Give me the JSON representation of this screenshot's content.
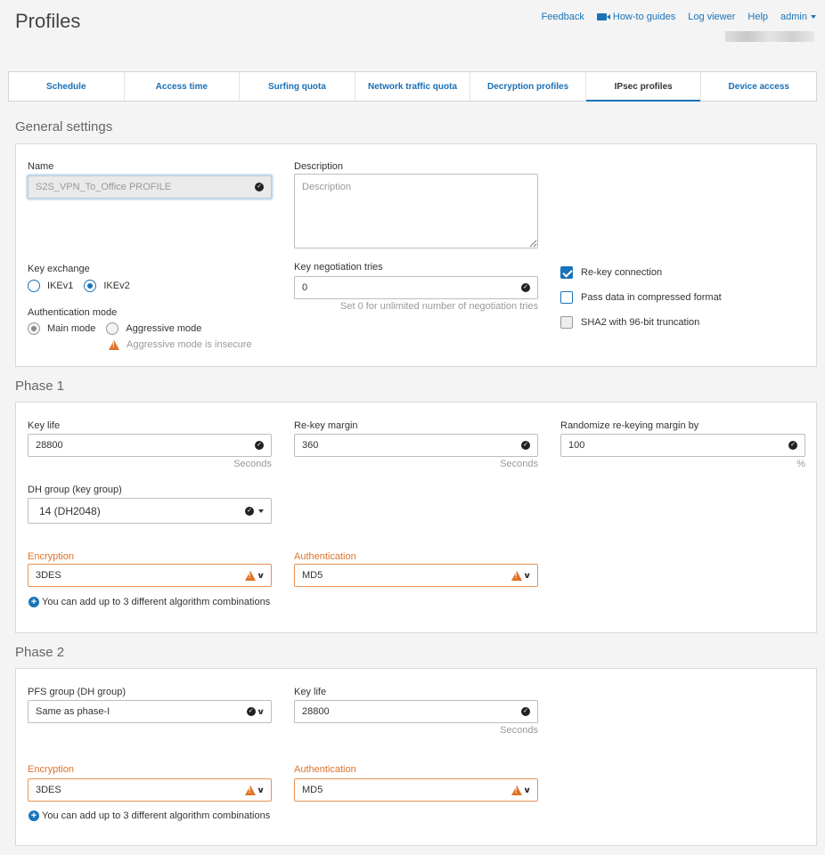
{
  "header": {
    "title": "Profiles",
    "nav": {
      "feedback": "Feedback",
      "how_to": "How-to guides",
      "log_viewer": "Log viewer",
      "help": "Help",
      "admin": "admin"
    }
  },
  "tabs": [
    "Schedule",
    "Access time",
    "Surfing quota",
    "Network traffic quota",
    "Decryption profiles",
    "IPsec profiles",
    "Device access"
  ],
  "active_tab": "IPsec profiles",
  "general": {
    "title": "General settings",
    "name_label": "Name",
    "name_value": "S2S_VPN_To_Office PROFILE",
    "desc_label": "Description",
    "desc_placeholder": "Description",
    "key_exchange_label": "Key exchange",
    "ikev1": "IKEv1",
    "ikev2": "IKEv2",
    "auth_mode_label": "Authentication mode",
    "main_mode": "Main mode",
    "aggressive_mode": "Aggressive mode",
    "aggressive_warning": "Aggressive mode is insecure",
    "key_tries_label": "Key negotiation tries",
    "key_tries_value": "0",
    "key_tries_hint": "Set 0 for unlimited number of negotiation tries",
    "rekey": "Re-key connection",
    "compress": "Pass data in compressed format",
    "sha2": "SHA2 with 96-bit truncation"
  },
  "phase1": {
    "title": "Phase 1",
    "key_life_label": "Key life",
    "key_life_value": "28800",
    "key_life_unit": "Seconds",
    "rekey_margin_label": "Re-key margin",
    "rekey_margin_value": "360",
    "rekey_margin_unit": "Seconds",
    "randomize_label": "Randomize re-keying margin by",
    "randomize_value": "100",
    "randomize_unit": "%",
    "dh_label": "DH group (key group)",
    "dh_value": "14 (DH2048)",
    "enc_label": "Encryption",
    "enc_value": "3DES",
    "auth_label": "Authentication",
    "auth_value": "MD5",
    "add_combo": "You can add up to 3 different algorithm combinations"
  },
  "phase2": {
    "title": "Phase 2",
    "pfs_label": "PFS group (DH group)",
    "pfs_value": "Same as phase-I",
    "key_life_label": "Key life",
    "key_life_value": "28800",
    "key_life_unit": "Seconds",
    "enc_label": "Encryption",
    "enc_value": "3DES",
    "auth_label": "Authentication",
    "auth_value": "MD5",
    "add_combo": "You can add up to 3 different algorithm combinations"
  },
  "colors": {
    "accent": "#1a73b8",
    "warning": "#e0722a"
  }
}
